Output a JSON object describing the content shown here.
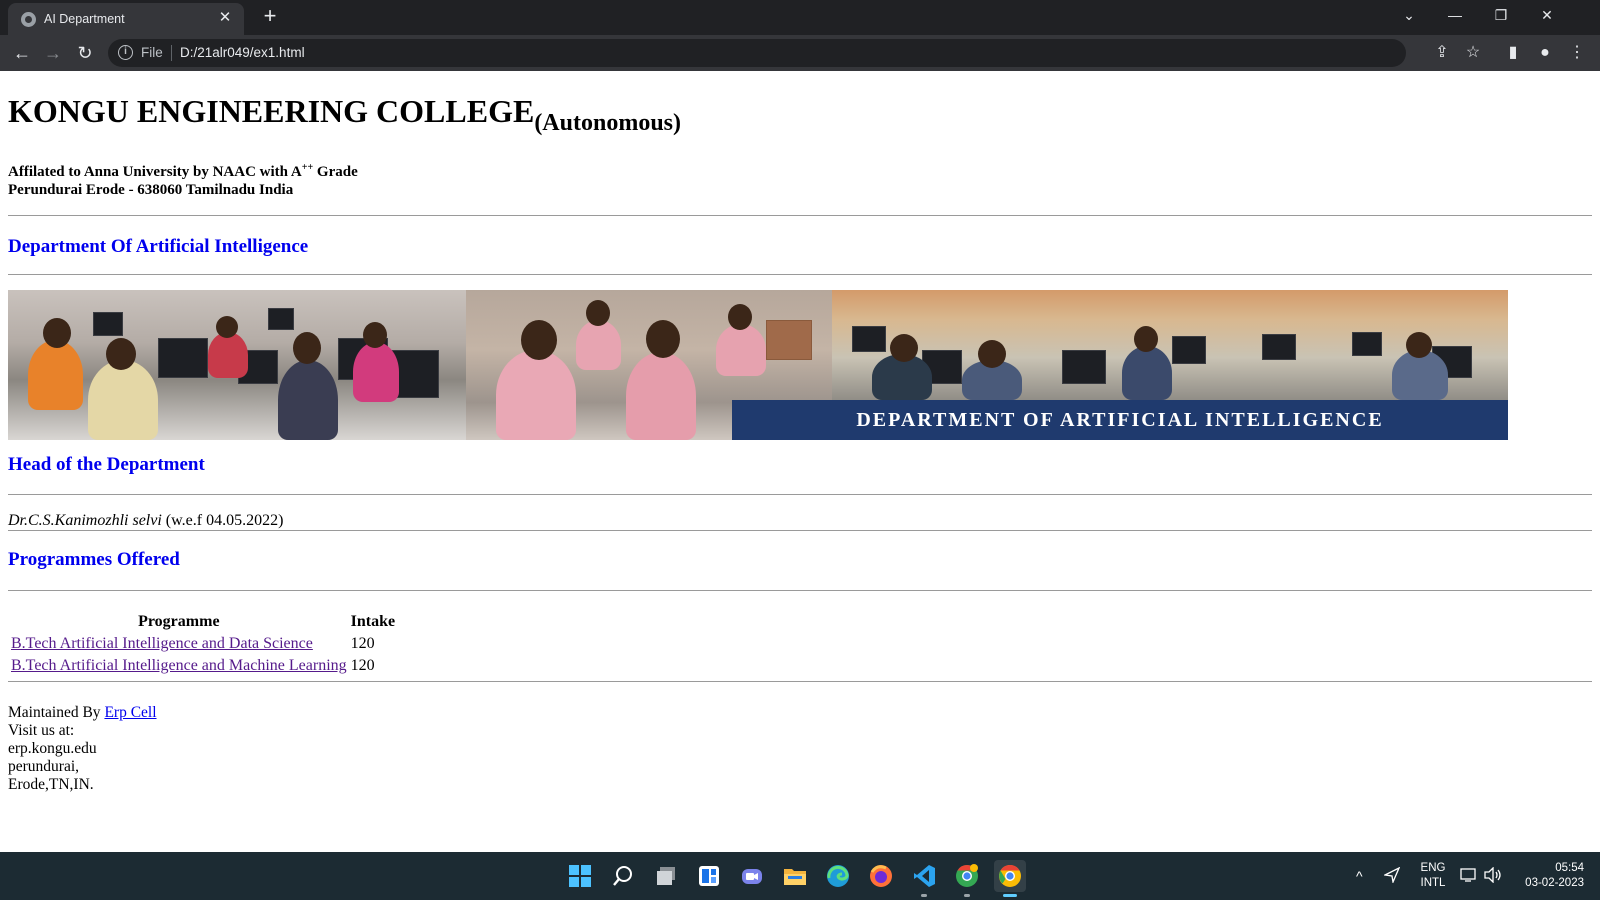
{
  "browser": {
    "tab_title": "AI Department",
    "tab_close": "✕",
    "new_tab": "+",
    "window_controls": {
      "tab_search": "⌄",
      "minimize": "—",
      "restore": "❐",
      "close": "✕"
    },
    "nav": {
      "back": "←",
      "forward": "→",
      "reload": "↻"
    },
    "address": {
      "scheme_label": "File",
      "url": "D:/21alr049/ex1.html",
      "info": "i"
    },
    "toolbar_icons": {
      "share": "⇪",
      "bookmark": "☆",
      "side_panel": "▮",
      "profile": "●",
      "menu": "⋮"
    }
  },
  "page": {
    "college_name": "KONGU ENGINEERING COLLEGE",
    "college_suffix": "(Autonomous)",
    "affiliation_prefix": "Affilated to Anna University by NAAC with A",
    "affiliation_grade_sup": "++",
    "affiliation_suffix": " Grade",
    "address_line": "Perundurai Erode - 638060 Tamilnadu India",
    "department_heading": "Department Of Artificial Intelligence",
    "banner_text": "DEPARTMENT OF ARTIFICIAL INTELLIGENCE",
    "hod_heading": "Head of the Department",
    "hod_name": "Dr.C.S.Kanimozhli selvi",
    "hod_since": " (w.e.f 04.05.2022)",
    "programmes_heading": "Programmes Offered",
    "programmes_table": {
      "headers": [
        "Programme",
        "Intake"
      ],
      "rows": [
        {
          "programme": "B.Tech Artificial Intelligence and Data Science",
          "intake": "120"
        },
        {
          "programme": "B.Tech Artificial Intelligence and Machine Learning",
          "intake": "120"
        }
      ]
    },
    "footer": {
      "maintained_prefix": "Maintained By ",
      "maintained_link": "Erp Cell",
      "visit_label": "Visit us at:",
      "address_lines": [
        "erp.kongu.edu",
        "perundurai,",
        "Erode,TN,IN."
      ]
    }
  },
  "taskbar": {
    "apps": [
      "start-icon",
      "search-icon",
      "task-view-icon",
      "widgets-icon",
      "teams-chat-icon",
      "file-explorer-icon",
      "edge-icon",
      "firefox-icon",
      "vscode-icon",
      "chrome-profile-icon",
      "chrome-icon"
    ],
    "tray": {
      "chevron": "^",
      "language_line1": "ENG",
      "language_line2": "INTL",
      "time": "05:54",
      "date": "03-02-2023"
    }
  },
  "colors": {
    "heading_blue": "#0000ee",
    "visited_link": "#551a8b",
    "banner_band": "#1f3a6e",
    "chrome_dark": "#202124",
    "chrome_toolbar": "#35363a",
    "taskbar": "#1c2b33"
  }
}
